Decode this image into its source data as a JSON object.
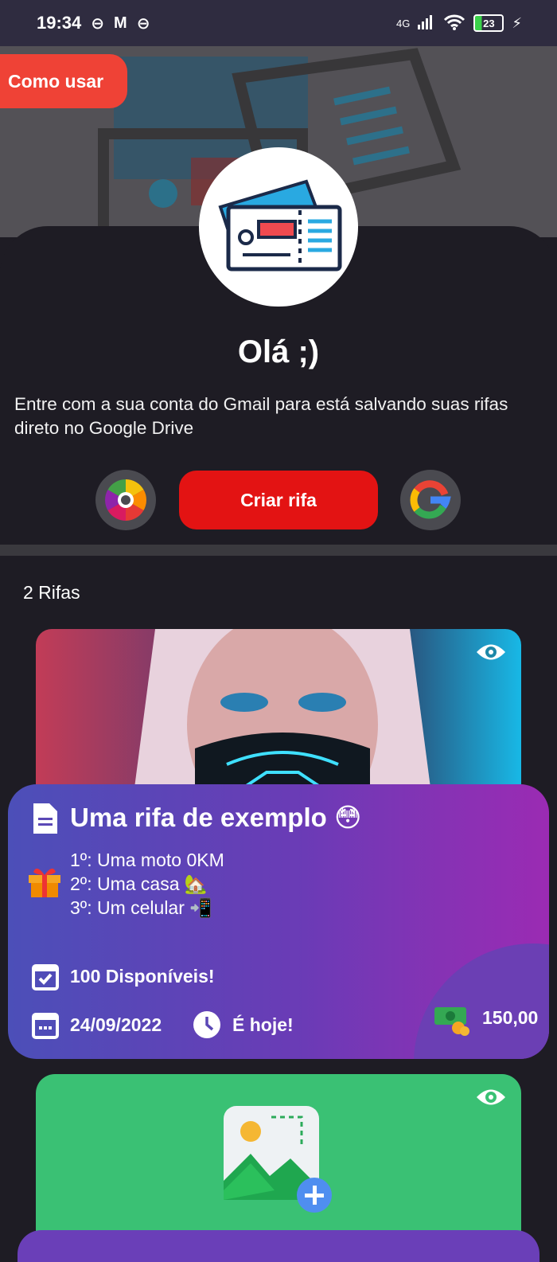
{
  "status": {
    "time": "19:34",
    "network": "4G",
    "battery": "23"
  },
  "hero": {
    "how_to_use": "Como usar"
  },
  "header": {
    "greeting": "Olá ;)",
    "description": "Entre com a sua conta do Gmail para está salvando suas rifas direto no Google Drive",
    "create_button": "Criar rifa"
  },
  "list": {
    "count_label": "2 Rifas"
  },
  "raffle": {
    "title": "Uma rifa de exemplo 😳",
    "prizes": [
      "1º: Uma moto 0KM",
      "2º: Uma casa 🏡",
      "3º: Um celular 📲"
    ],
    "available": "100 Disponíveis!",
    "date": "24/09/2022",
    "when": "É hoje!",
    "price": "150,00"
  },
  "colors": {
    "create_button": "#e31313",
    "how_to_use": "#ef4236",
    "card2": "#3ac174"
  }
}
